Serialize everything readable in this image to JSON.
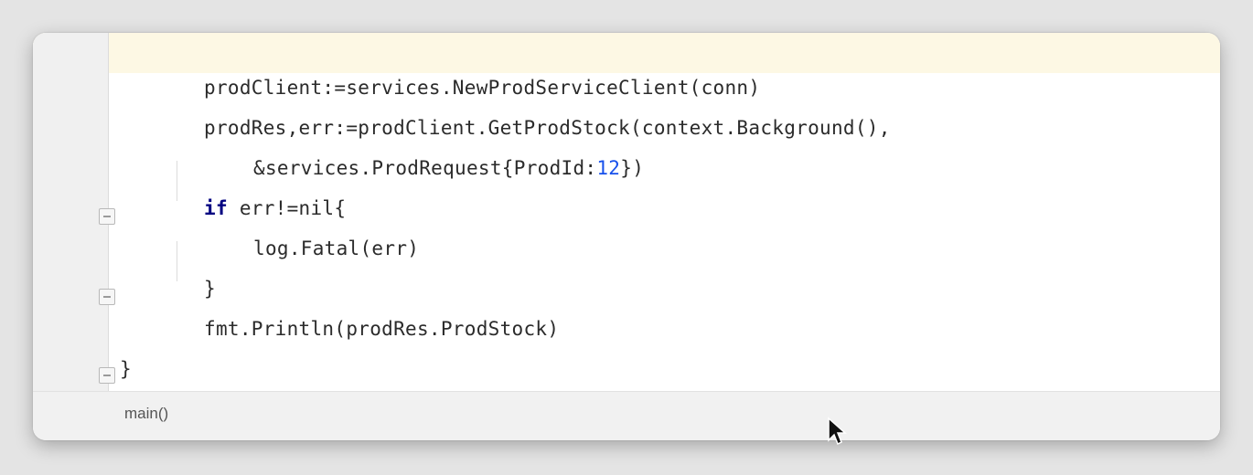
{
  "editor": {
    "lines": [
      {
        "indent": 1,
        "parts": [
          {
            "text": "prodClient:=services.NewProdServiceClient(conn)"
          }
        ]
      },
      {
        "indent": 1,
        "parts": [
          {
            "text": "prodRes,err:=prodClient.GetProdStock(context.Background(),"
          }
        ]
      },
      {
        "indent": 2,
        "parts": [
          {
            "text": "&services.ProdRequest{ProdId:"
          },
          {
            "text": "12",
            "cls": "num"
          },
          {
            "text": "})"
          }
        ]
      },
      {
        "indent": 1,
        "parts": [
          {
            "text": "if",
            "cls": "kw"
          },
          {
            "text": " err!=nil{"
          }
        ]
      },
      {
        "indent": 2,
        "parts": [
          {
            "text": "log.Fatal(err)"
          }
        ]
      },
      {
        "indent": 1,
        "parts": [
          {
            "text": "}"
          }
        ]
      },
      {
        "indent": 1,
        "parts": [
          {
            "text": "fmt.Println(prodRes.ProdStock)"
          }
        ]
      },
      {
        "indent": 0,
        "parts": [
          {
            "text": "}"
          }
        ]
      }
    ],
    "fold_markers": [
      "fold-open-if",
      "fold-close-if",
      "fold-close-func"
    ]
  },
  "statusbar": {
    "breadcrumb": "main()"
  },
  "colors": {
    "current_line": "#fdf8e4",
    "keyword": "#000080",
    "number": "#1750eb",
    "text": "#2b2b2b"
  },
  "icons": {
    "cursor": "mouse-pointer-icon",
    "fold": "fold-marker-icon"
  }
}
